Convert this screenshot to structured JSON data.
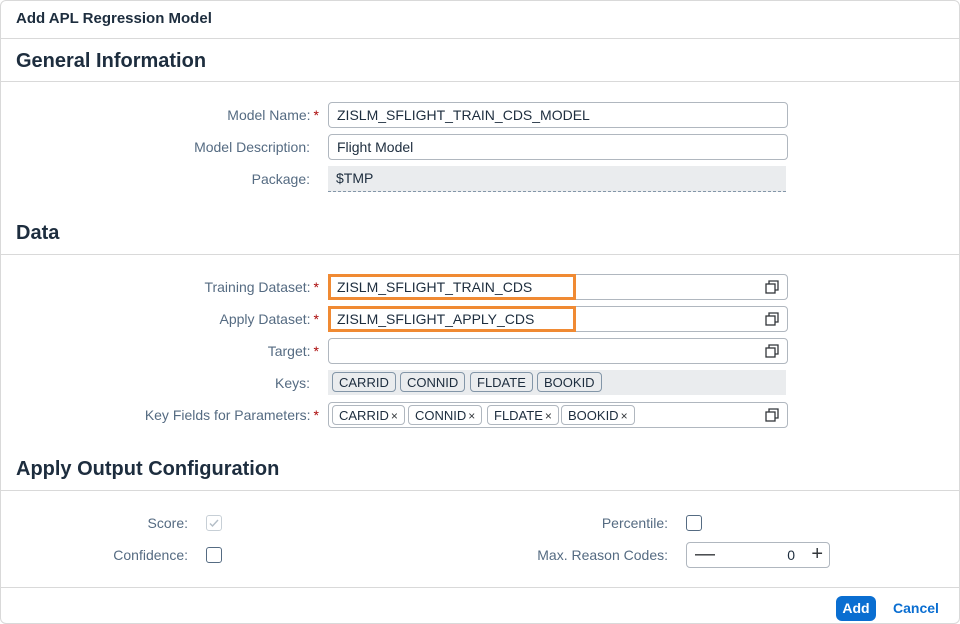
{
  "dialog": {
    "title": "Add APL Regression Model"
  },
  "general": {
    "title": "General Information",
    "model_name": {
      "label": "Model Name:",
      "required": "*",
      "value": "ZISLM_SFLIGHT_TRAIN_CDS_MODEL"
    },
    "model_description": {
      "label": "Model Description:",
      "value": "Flight Model"
    },
    "package": {
      "label": "Package:",
      "value": "$TMP"
    }
  },
  "data": {
    "title": "Data",
    "training_dataset": {
      "label": "Training Dataset:",
      "required": "*",
      "value": "ZISLM_SFLIGHT_TRAIN_CDS"
    },
    "apply_dataset": {
      "label": "Apply Dataset:",
      "required": "*",
      "value": "ZISLM_SFLIGHT_APPLY_CDS"
    },
    "target": {
      "label": "Target:",
      "required": "*",
      "value": ""
    },
    "keys": {
      "label": "Keys:",
      "tokens": [
        "CARRID",
        "CONNID",
        "FLDATE",
        "BOOKID"
      ]
    },
    "key_fields": {
      "label": "Key Fields for Parameters:",
      "required": "*",
      "tokens": [
        "CARRID",
        "CONNID",
        "FLDATE",
        "BOOKID"
      ],
      "remove_glyph": "×"
    }
  },
  "output": {
    "title": "Apply Output Configuration",
    "score": {
      "label": "Score:",
      "checked": true,
      "enabled": false
    },
    "confidence": {
      "label": "Confidence:",
      "checked": false
    },
    "percentile": {
      "label": "Percentile:",
      "checked": false
    },
    "max_reason_codes": {
      "label": "Max. Reason Codes:",
      "value": "0",
      "minus": "—",
      "plus": "+"
    }
  },
  "footer": {
    "add_label": "Add",
    "cancel_label": "Cancel"
  },
  "colors": {
    "accent": "#0a6ed1",
    "highlight": "#f08a33",
    "required": "#aa0808"
  }
}
